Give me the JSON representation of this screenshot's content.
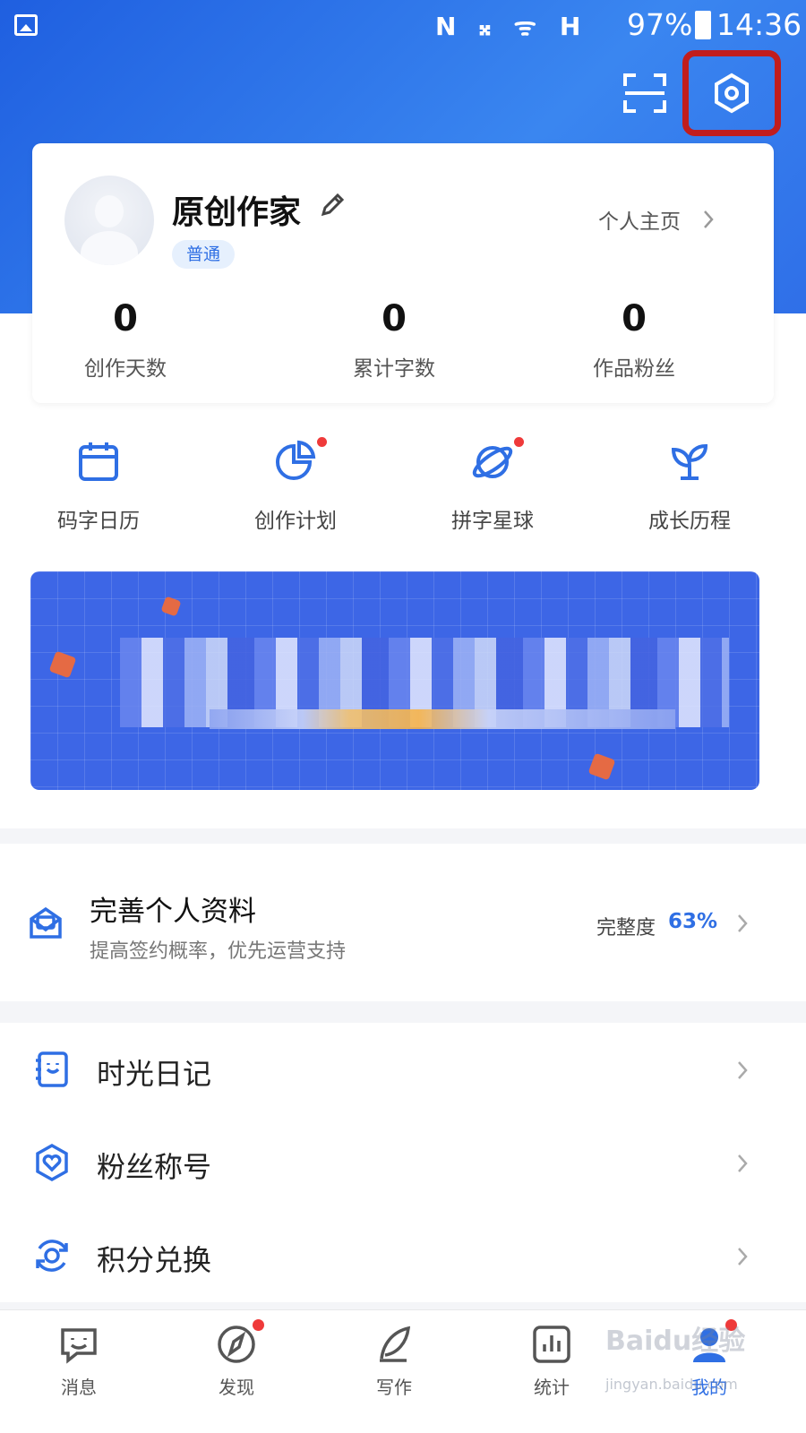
{
  "status_bar": {
    "icons": "N 𝄪 ᯤ H",
    "battery": "97%",
    "time": "14:36"
  },
  "header": {
    "scan_icon": "scan-icon",
    "settings_icon": "settings-icon"
  },
  "profile": {
    "name": "原创作家",
    "level_badge": "普通",
    "homepage_link": "个人主页",
    "stats": [
      {
        "value": "0",
        "label": "创作天数"
      },
      {
        "value": "0",
        "label": "累计字数"
      },
      {
        "value": "0",
        "label": "作品粉丝"
      }
    ]
  },
  "quick_entries": [
    {
      "label": "码字日历",
      "icon": "calendar-icon",
      "has_dot": false
    },
    {
      "label": "创作计划",
      "icon": "pie-chart-icon",
      "has_dot": true
    },
    {
      "label": "拼字星球",
      "icon": "planet-icon",
      "has_dot": true
    },
    {
      "label": "成长历程",
      "icon": "sprout-icon",
      "has_dot": false
    }
  ],
  "profile_completion": {
    "title": "完善个人资料",
    "subtitle": "提高签约概率，优先运营支持",
    "progress_label": "完整度",
    "progress_value": "63%"
  },
  "menu": [
    {
      "label": "时光日记",
      "icon": "diary-icon"
    },
    {
      "label": "粉丝称号",
      "icon": "fan-badge-icon"
    },
    {
      "label": "积分兑换",
      "icon": "points-exchange-icon"
    }
  ],
  "bottom_nav": [
    {
      "label": "消息",
      "icon": "message-icon",
      "has_dot": false,
      "active": false
    },
    {
      "label": "发现",
      "icon": "compass-icon",
      "has_dot": true,
      "active": false
    },
    {
      "label": "写作",
      "icon": "feather-pen-icon",
      "has_dot": false,
      "active": false
    },
    {
      "label": "统计",
      "icon": "bar-chart-icon",
      "has_dot": false,
      "active": false
    },
    {
      "label": "我的",
      "icon": "person-icon",
      "has_dot": true,
      "active": true
    }
  ],
  "watermark": {
    "text": "Baidu经验",
    "sub": "jingyan.baidu.com"
  },
  "colors": {
    "primary": "#2f6fe4",
    "header_start": "#1f5fe0",
    "highlight_box": "#c11d1d",
    "dot": "#ef3a3a"
  }
}
